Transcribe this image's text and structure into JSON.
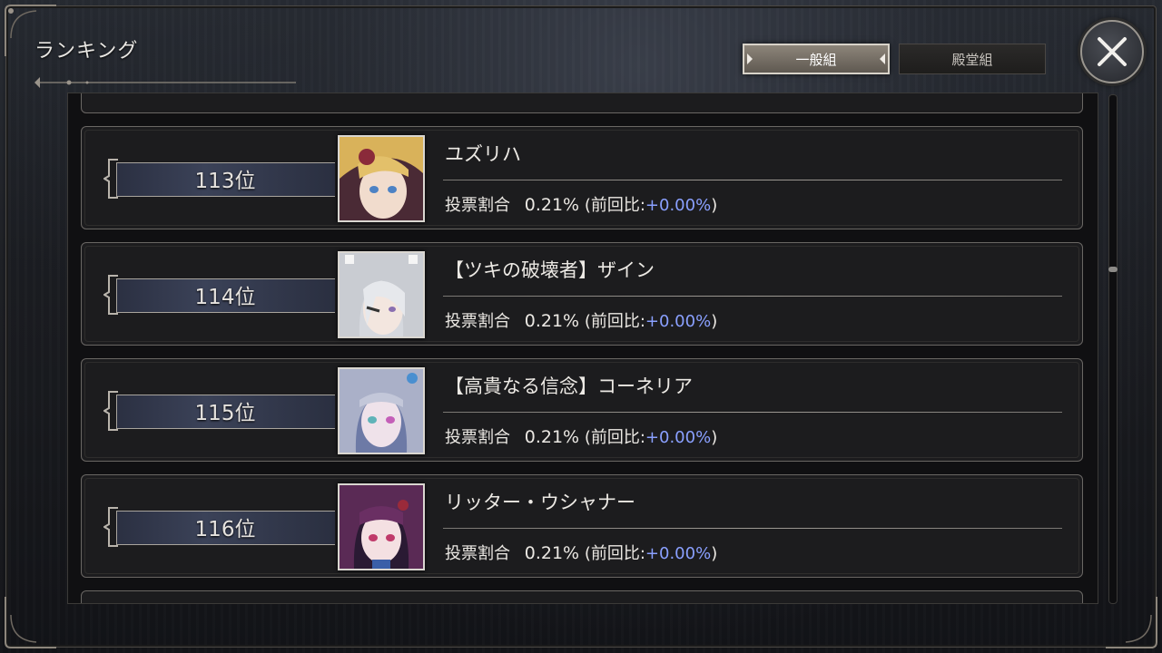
{
  "header": {
    "title": "ランキング"
  },
  "tabs": [
    {
      "label": "一般組",
      "active": true
    },
    {
      "label": "殿堂組",
      "active": false
    }
  ],
  "close_button": {
    "icon": "close-x-icon"
  },
  "ranking": {
    "items": [
      {
        "rank": "113位",
        "name": "ユズリハ",
        "vote_label": "投票割合",
        "vote_pct": "0.21%",
        "prev_prefix": "(前回比:",
        "prev_diff": "+0.00%",
        "prev_suffix": ")",
        "portrait_color": "#d9b25a"
      },
      {
        "rank": "114位",
        "name": "【ツキの破壊者】ザイン",
        "vote_label": "投票割合",
        "vote_pct": "0.21%",
        "prev_prefix": "(前回比:",
        "prev_diff": "+0.00%",
        "prev_suffix": ")",
        "portrait_color": "#c9ccd2"
      },
      {
        "rank": "115位",
        "name": "【高貴なる信念】コーネリア",
        "vote_label": "投票割合",
        "vote_pct": "0.21%",
        "prev_prefix": "(前回比:",
        "prev_diff": "+0.00%",
        "prev_suffix": ")",
        "portrait_color": "#aab0c8"
      },
      {
        "rank": "116位",
        "name": "リッター・ウシャナー",
        "vote_label": "投票割合",
        "vote_pct": "0.21%",
        "prev_prefix": "(前回比:",
        "prev_diff": "+0.00%",
        "prev_suffix": ")",
        "portrait_color": "#5a2a55"
      }
    ]
  },
  "colors": {
    "diff_text": "#8aa0ff",
    "rank_plate": "#3b4258"
  }
}
